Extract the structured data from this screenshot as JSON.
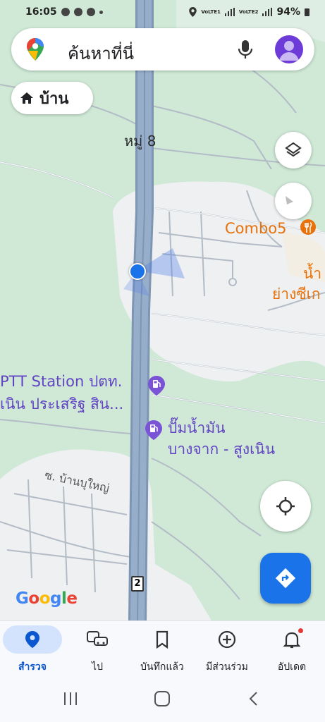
{
  "status": {
    "time": "16:05",
    "network1": "VoLTE1",
    "network2": "VoLTE2",
    "battery": "94%"
  },
  "search": {
    "placeholder": "ค้นหาที่นี่"
  },
  "home_chip": {
    "label": "บ้าน"
  },
  "map_labels": {
    "village": "หมู่ 8",
    "restaurant": "Combo5",
    "place_line1": "น้ำ",
    "place_line2": "ย่างซีเก",
    "ptt_line1": "PTT Station ปตท.",
    "ptt_line2": "เนิน ประเสริฐ สิน...",
    "pump_line1": "ปั๊มน้ำมัน",
    "pump_line2": "บางจาก - สูงเนิน",
    "soi": "ซ. บ้านบุใหญ่",
    "route_number": "2"
  },
  "google": {
    "letters": [
      "G",
      "o",
      "o",
      "g",
      "l",
      "e"
    ],
    "colors": [
      "#4285f4",
      "#ea4335",
      "#fbbc05",
      "#4285f4",
      "#34a853",
      "#ea4335"
    ]
  },
  "bottom_nav": {
    "items": [
      {
        "label": "สำรวจ",
        "icon": "explore-pin-icon",
        "active": true
      },
      {
        "label": "ไป",
        "icon": "commute-icon",
        "active": false
      },
      {
        "label": "บันทึกแล้ว",
        "icon": "bookmark-icon",
        "active": false
      },
      {
        "label": "มีส่วนร่วม",
        "icon": "add-circle-icon",
        "active": false
      },
      {
        "label": "อัปเดต",
        "icon": "bell-icon",
        "active": false
      }
    ]
  },
  "colors": {
    "accent": "#1a73e8",
    "map_green": "#cfe9d6",
    "road": "#8fa8c8",
    "poi_orange": "#e8710a",
    "poi_purple": "#6243c4"
  }
}
